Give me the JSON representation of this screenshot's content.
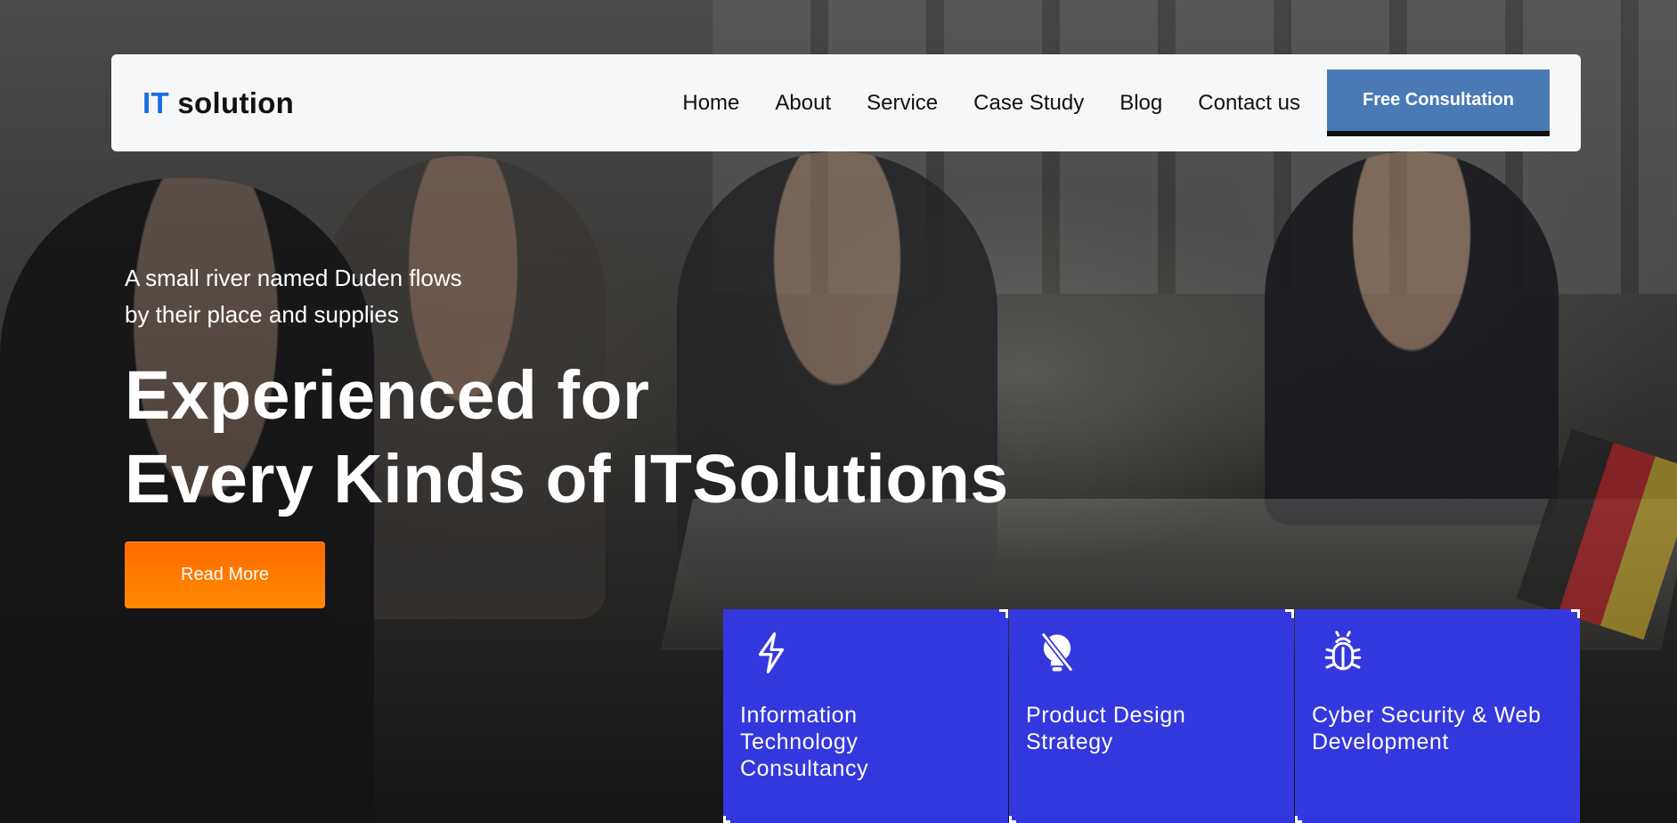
{
  "brand": {
    "accent": "IT",
    "rest": " solution",
    "accent_color": "#1a6fe0"
  },
  "nav": {
    "links": [
      "Home",
      "About",
      "Service",
      "Case Study",
      "Blog",
      "Contact us"
    ],
    "cta_label": "Free Consultation"
  },
  "hero": {
    "subtitle_line1": "A small river named Duden flows",
    "subtitle_line2": "by their place and supplies",
    "title_line1": "Experienced for",
    "title_line2": "Every Kinds of ITSolutions",
    "button_label": "Read More"
  },
  "cards": [
    {
      "icon": "lightning-icon",
      "label": "Information Technology Consultancy"
    },
    {
      "icon": "lightbulb-off-icon",
      "label": "Product Design Strategy"
    },
    {
      "icon": "bug-icon",
      "label": "Cyber Security & Web Development"
    }
  ],
  "colors": {
    "card_bg": "#3338de",
    "cta_bg": "#4a7ab5",
    "read_more": "#ff7a00"
  }
}
